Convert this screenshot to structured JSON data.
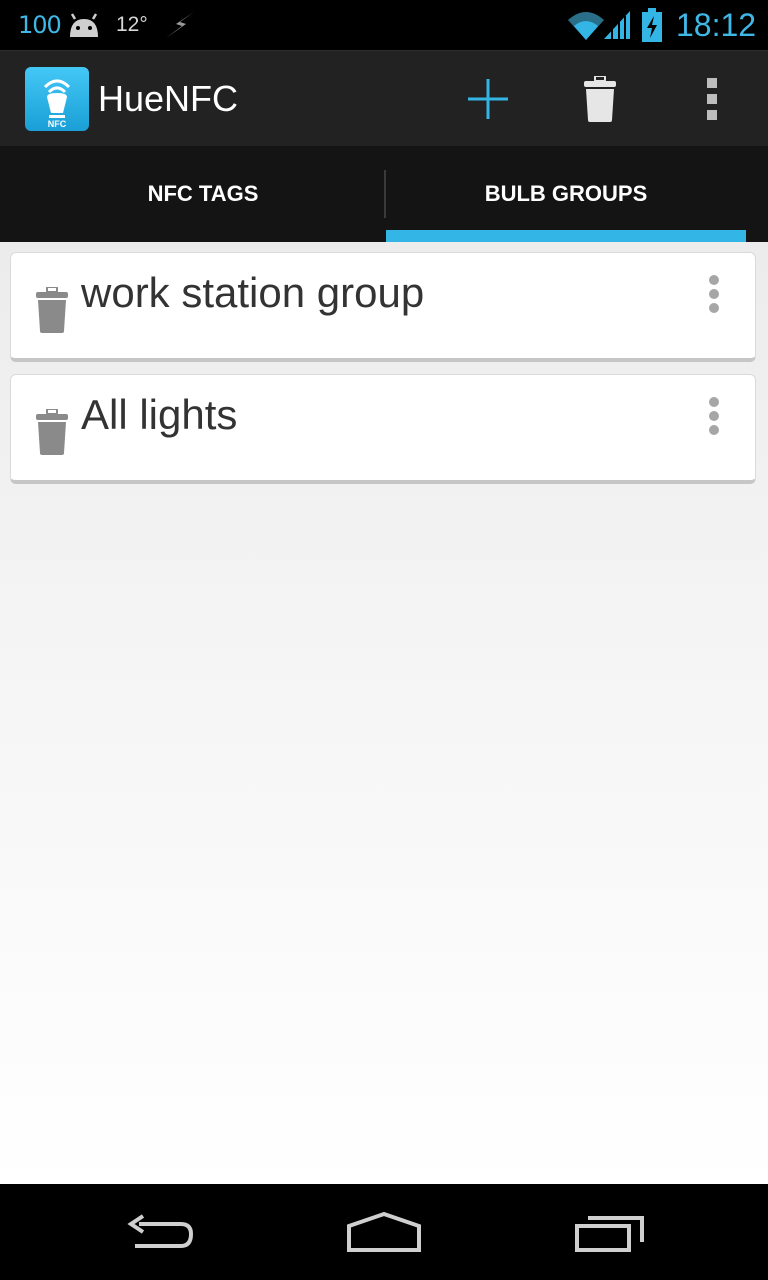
{
  "status_bar": {
    "battery_percent": "100",
    "temperature": "12°",
    "time": "18:12",
    "icons": [
      "android-icon",
      "flash-icon",
      "wifi-icon",
      "signal-icon",
      "battery-charging-icon"
    ],
    "accent_color": "#33b5e5"
  },
  "action_bar": {
    "title": "HueNFC",
    "app_icon_label": "NFC",
    "actions": [
      {
        "name": "add",
        "icon": "plus-icon"
      },
      {
        "name": "delete",
        "icon": "trash-icon"
      },
      {
        "name": "overflow",
        "icon": "overflow-menu-icon"
      }
    ]
  },
  "tabs": [
    {
      "label": "NFC TAGS",
      "selected": false
    },
    {
      "label": "BULB GROUPS",
      "selected": true
    }
  ],
  "groups": [
    {
      "name": "work station group",
      "icon": "trash-icon"
    },
    {
      "name": "All lights",
      "icon": "trash-icon"
    }
  ],
  "nav_bar": {
    "buttons": [
      "back-icon",
      "home-icon",
      "recents-icon"
    ]
  }
}
